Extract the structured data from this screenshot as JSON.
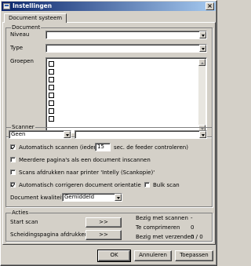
{
  "window": {
    "title": "Instellingen",
    "close_label": "×"
  },
  "tabs": [
    {
      "label": "Document systeem"
    }
  ],
  "document": {
    "legend": "Document",
    "niveau_label": "Niveau",
    "niveau_value": "",
    "type_label": "Type",
    "type_value": "",
    "groepen_label": "Groepen",
    "groepen_items": [
      false,
      false,
      false,
      false,
      false,
      false,
      false,
      false
    ]
  },
  "scanner": {
    "legend": "Scanner",
    "device_value": "Geen",
    "source_value": "",
    "auto_scan_label": "Automatisch scannen (iedere",
    "auto_scan_checked": true,
    "interval_value": "15",
    "interval_suffix": "sec. de feeder controleren)",
    "multi_page_label": "Meerdere pagina's als een document inscannen",
    "multi_page_checked": false,
    "print_label": "Scans afdrukken naar printer 'Intelly (Scankopie)'",
    "print_checked": false,
    "orientation_label": "Automatisch corrigeren document orientatie",
    "orientation_checked": true,
    "bulk_label": "Bulk scan",
    "bulk_checked": false,
    "quality_label": "Document kwaliteit",
    "quality_value": "Gemiddeld"
  },
  "acties": {
    "legend": "Acties",
    "start_scan_label": "Start scan",
    "start_scan_button": ">>",
    "separator_label": "Scheidingspagina afdrukken",
    "separator_button": ">>",
    "status": [
      {
        "label": "Bezig met scannen",
        "value": "-"
      },
      {
        "label": "Te comprimeren",
        "value": "0"
      },
      {
        "label": "Bezig met verzenden",
        "value": "0 / 0"
      }
    ]
  },
  "footer": {
    "ok_label": "OK",
    "cancel_label": "Annuleren",
    "apply_label": "Toepassen"
  }
}
